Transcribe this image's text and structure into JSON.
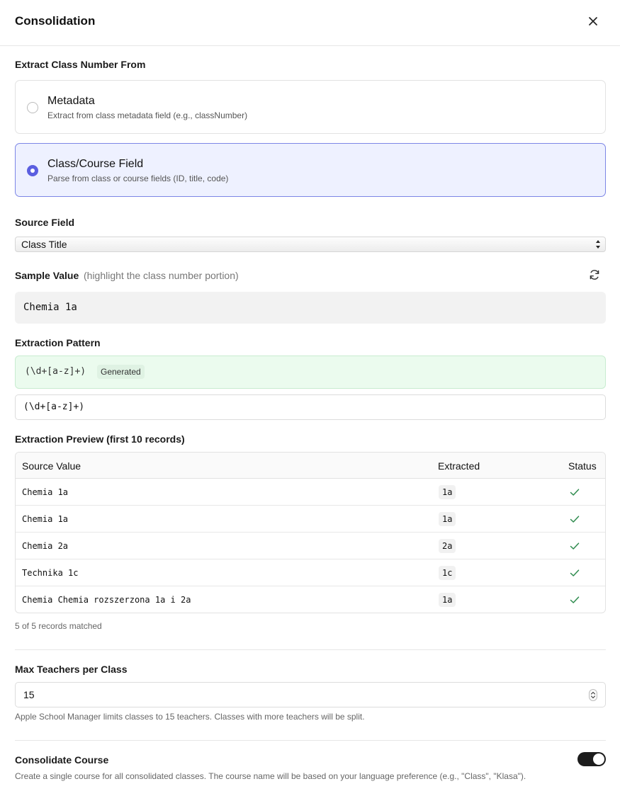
{
  "header": {
    "title": "Consolidation"
  },
  "extract": {
    "label": "Extract Class Number From",
    "options": [
      {
        "title": "Metadata",
        "description": "Extract from class metadata field (e.g., classNumber)",
        "selected": false
      },
      {
        "title": "Class/Course Field",
        "description": "Parse from class or course fields (ID, title, code)",
        "selected": true
      }
    ]
  },
  "source_field": {
    "label": "Source Field",
    "selected": "Class Title"
  },
  "sample": {
    "label": "Sample Value",
    "hint": "(highlight the class number portion)",
    "value": "Chemia 1a"
  },
  "pattern": {
    "label": "Extraction Pattern",
    "generated_value": "(\\d+[a-z]+)",
    "badge": "Generated",
    "input_value": "(\\d+[a-z]+)"
  },
  "preview": {
    "label": "Extraction Preview (first 10 records)",
    "columns": [
      "Source Value",
      "Extracted",
      "Status"
    ],
    "rows": [
      {
        "source": "Chemia 1a",
        "extracted": "1a",
        "status": "ok"
      },
      {
        "source": "Chemia 1a",
        "extracted": "1a",
        "status": "ok"
      },
      {
        "source": "Chemia 2a",
        "extracted": "2a",
        "status": "ok"
      },
      {
        "source": "Technika 1c",
        "extracted": "1c",
        "status": "ok"
      },
      {
        "source": "Chemia Chemia rozszerzona 1a i 2a",
        "extracted": "1a",
        "status": "ok"
      }
    ],
    "matched": "5 of 5 records matched"
  },
  "max_teachers": {
    "label": "Max Teachers per Class",
    "value": "15",
    "help": "Apple School Manager limits classes to 15 teachers. Classes with more teachers will be split."
  },
  "consolidate_course": {
    "label": "Consolidate Course",
    "description": "Create a single course for all consolidated classes. The course name will be based on your language preference (e.g., \"Class\", \"Klasa\").",
    "enabled": true
  },
  "colors": {
    "accent": "#5b5fe0",
    "success": "#2e8b4e",
    "pattern_bg": "#ebfbee",
    "selected_bg": "#eef1ff"
  },
  "icons": {
    "close": "close-icon",
    "refresh": "refresh-icon",
    "status": "check-icon"
  }
}
